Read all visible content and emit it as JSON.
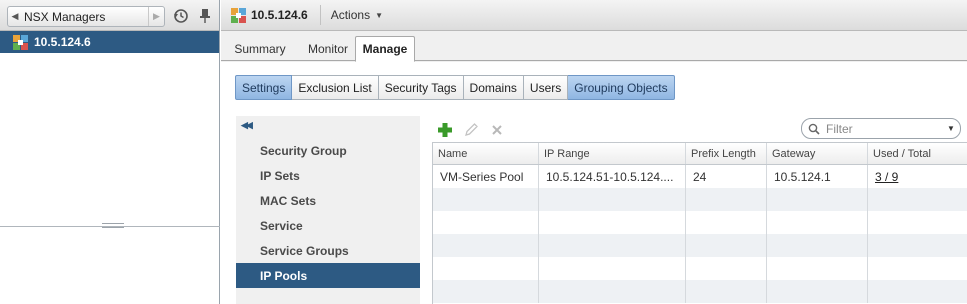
{
  "navigator": {
    "back_label": "NSX Managers",
    "selected_item": "10.5.124.6"
  },
  "object": {
    "title": "10.5.124.6",
    "actions_label": "Actions"
  },
  "tabs": [
    {
      "label": "Summary"
    },
    {
      "label": "Monitor"
    },
    {
      "label": "Manage"
    }
  ],
  "subtabs": [
    {
      "label": "Settings"
    },
    {
      "label": "Exclusion List"
    },
    {
      "label": "Security Tags"
    },
    {
      "label": "Domains"
    },
    {
      "label": "Users"
    },
    {
      "label": "Grouping Objects"
    }
  ],
  "grouping_objects": [
    {
      "label": "Security Group"
    },
    {
      "label": "IP Sets"
    },
    {
      "label": "MAC Sets"
    },
    {
      "label": "Service"
    },
    {
      "label": "Service Groups"
    },
    {
      "label": "IP Pools"
    }
  ],
  "filter": {
    "placeholder": "Filter"
  },
  "grid": {
    "columns": [
      "Name",
      "IP Range",
      "Prefix Length",
      "Gateway",
      "Used / Total"
    ],
    "rows": [
      {
        "name": "VM-Series Pool",
        "ip_range": "10.5.124.51-10.5.124....",
        "prefix_length": "24",
        "gateway": "10.5.124.1",
        "used_total": "3 / 9"
      }
    ]
  },
  "colors": {
    "selection": "#2d5a83",
    "active_subtab": "#8fb6e2",
    "add_icon": "#3a9a2a"
  }
}
